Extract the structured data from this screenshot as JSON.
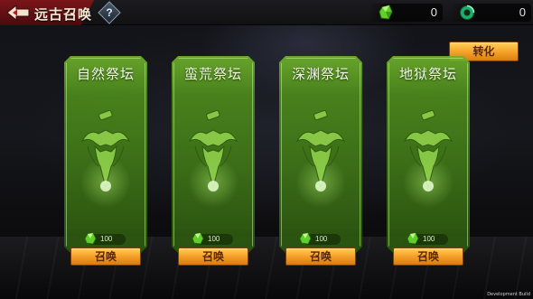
{
  "header": {
    "title": "远古召唤",
    "help_label": "?"
  },
  "currencies": [
    {
      "icon": "green-crystal-icon",
      "value": "0"
    },
    {
      "icon": "jade-ring-icon",
      "value": "0"
    }
  ],
  "convert_button": "转化",
  "altars": [
    {
      "name": "自然祭坛",
      "cost": "100",
      "button": "召唤"
    },
    {
      "name": "蛮荒祭坛",
      "cost": "100",
      "button": "召唤"
    },
    {
      "name": "深渊祭坛",
      "cost": "100",
      "button": "召唤"
    },
    {
      "name": "地狱祭坛",
      "cost": "100",
      "button": "召唤"
    }
  ],
  "footer": {
    "build_label": "Development Build"
  },
  "colors": {
    "card_green": "#4d8a1c",
    "button_orange": "#f39b24",
    "title_red": "#7a1619"
  }
}
